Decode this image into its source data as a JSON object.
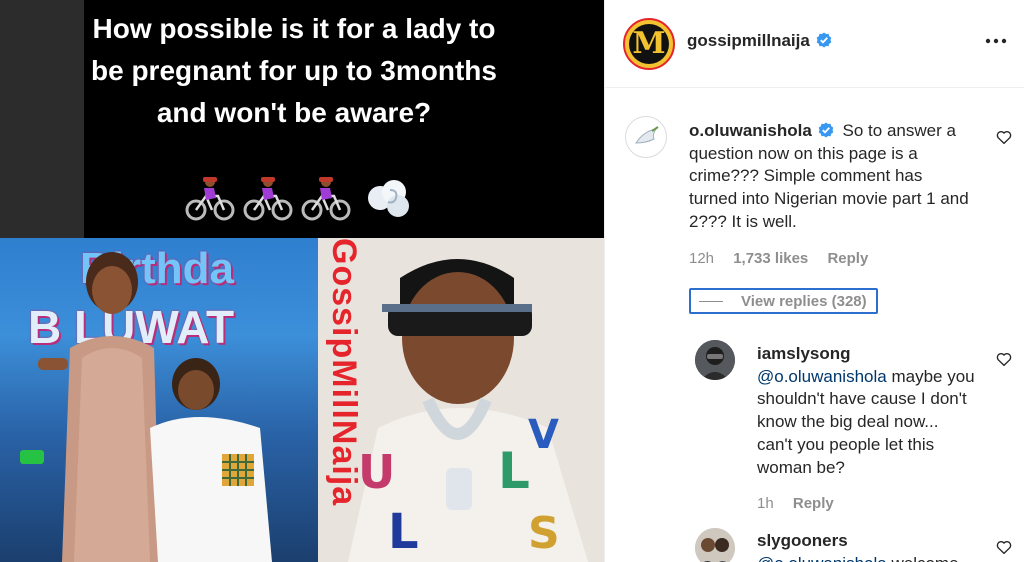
{
  "media": {
    "headline": "How possible is it for a lady to be pregnant for up to 3months and won't be aware?",
    "emojis": [
      "bicyclist-emoji",
      "bicyclist-emoji",
      "bicyclist-emoji",
      "dashing-away-emoji"
    ],
    "banner_text_1": "Birthda",
    "banner_text_2": "B   LUWAT",
    "watermark": "GossipMillNaija"
  },
  "post": {
    "username": "gossipmillnaija",
    "avatar_letter": "M",
    "verified": true,
    "more_icon": "more-options-icon"
  },
  "comments": [
    {
      "username": "o.oluwanishola",
      "verified": true,
      "text": "So to answer a question now on this page is a crime??? Simple comment has turned into Nigerian movie part 1 and 2??? It is well.",
      "time": "12h",
      "likes": "1,733 likes",
      "reply_label": "Reply"
    }
  ],
  "view_replies": "View replies (328)",
  "replies": [
    {
      "username": "iamslysong",
      "mention": "@o.oluwanishola",
      "text": " maybe you shouldn't have cause I don't know the big deal now... can't you people let this woman be?",
      "time": "1h",
      "reply_label": "Reply"
    },
    {
      "username": "slygooners",
      "mention": "@o.oluwanishola",
      "text": " welcome"
    }
  ],
  "colors": {
    "accent_blue": "#2c6fcf",
    "verified_blue": "#3897f0",
    "watermark_red": "#e5242c",
    "meta_gray": "#8e8e8e"
  }
}
